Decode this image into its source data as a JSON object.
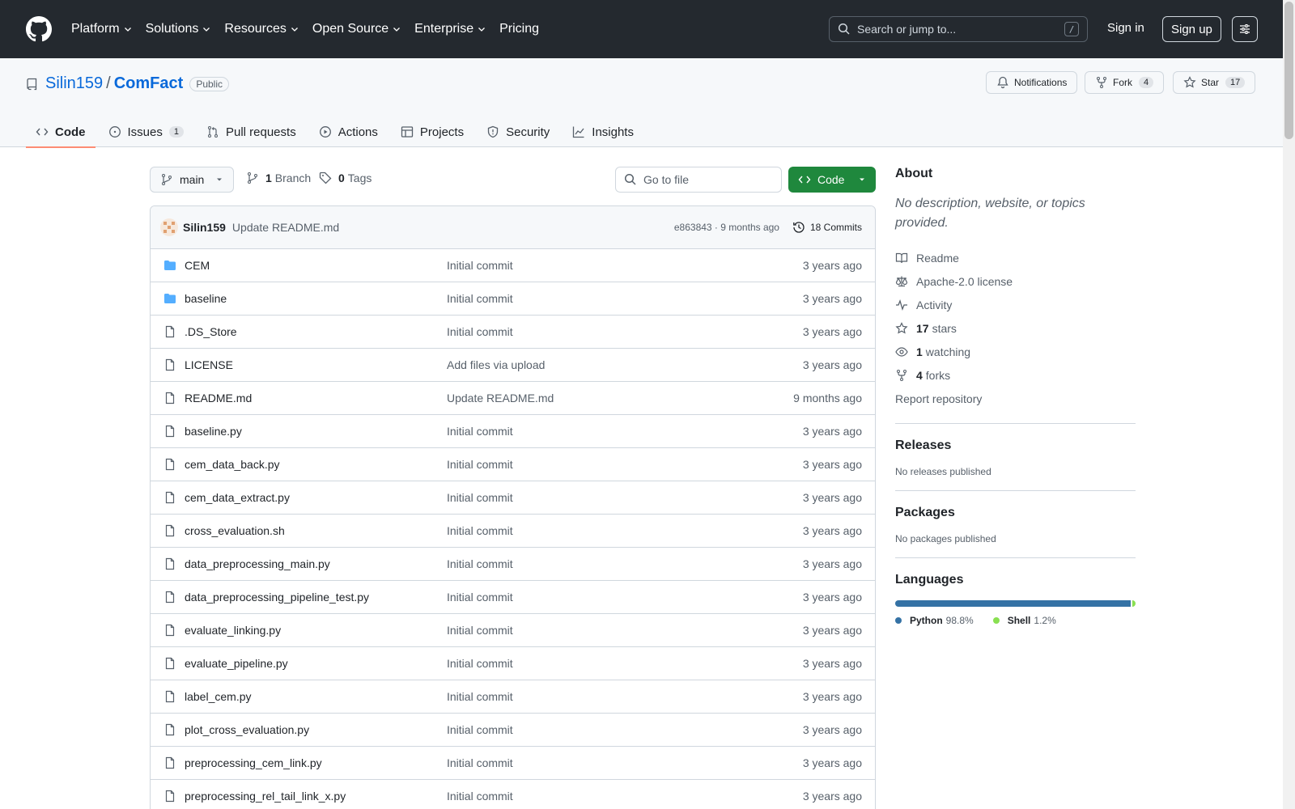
{
  "header": {
    "nav": [
      {
        "label": "Platform",
        "dropdown": true
      },
      {
        "label": "Solutions",
        "dropdown": true
      },
      {
        "label": "Resources",
        "dropdown": true
      },
      {
        "label": "Open Source",
        "dropdown": true
      },
      {
        "label": "Enterprise",
        "dropdown": true
      },
      {
        "label": "Pricing",
        "dropdown": false
      }
    ],
    "search_placeholder": "Search or jump to...",
    "search_shortcut": "/",
    "signin": "Sign in",
    "signup": "Sign up"
  },
  "repo": {
    "owner": "Silin159",
    "separator": "/",
    "name": "ComFact",
    "visibility": "Public",
    "notifications_label": "Notifications",
    "fork_label": "Fork",
    "fork_count": "4",
    "star_label": "Star",
    "star_count": "17"
  },
  "tabs": [
    {
      "label": "Code",
      "icon": "code-icon",
      "count": ""
    },
    {
      "label": "Issues",
      "icon": "issue-icon",
      "count": "1"
    },
    {
      "label": "Pull requests",
      "icon": "pull-request-icon",
      "count": ""
    },
    {
      "label": "Actions",
      "icon": "play-icon",
      "count": ""
    },
    {
      "label": "Projects",
      "icon": "table-icon",
      "count": ""
    },
    {
      "label": "Security",
      "icon": "shield-icon",
      "count": ""
    },
    {
      "label": "Insights",
      "icon": "graph-icon",
      "count": ""
    }
  ],
  "toolbar": {
    "branch": "main",
    "branches_count": "1",
    "branches_label": "Branch",
    "tags_count": "0",
    "tags_label": "Tags",
    "goto_placeholder": "Go to file",
    "code_label": "Code"
  },
  "last_commit": {
    "author": "Silin159",
    "message": "Update README.md",
    "sha_time": "e863843 · 9 months ago",
    "commits_label": "18 Commits"
  },
  "files": [
    {
      "name": "CEM",
      "type": "dir",
      "message": "Initial commit",
      "age": "3 years ago"
    },
    {
      "name": "baseline",
      "type": "dir",
      "message": "Initial commit",
      "age": "3 years ago"
    },
    {
      "name": ".DS_Store",
      "type": "file",
      "message": "Initial commit",
      "age": "3 years ago"
    },
    {
      "name": "LICENSE",
      "type": "file",
      "message": "Add files via upload",
      "age": "3 years ago"
    },
    {
      "name": "README.md",
      "type": "file",
      "message": "Update README.md",
      "age": "9 months ago"
    },
    {
      "name": "baseline.py",
      "type": "file",
      "message": "Initial commit",
      "age": "3 years ago"
    },
    {
      "name": "cem_data_back.py",
      "type": "file",
      "message": "Initial commit",
      "age": "3 years ago"
    },
    {
      "name": "cem_data_extract.py",
      "type": "file",
      "message": "Initial commit",
      "age": "3 years ago"
    },
    {
      "name": "cross_evaluation.sh",
      "type": "file",
      "message": "Initial commit",
      "age": "3 years ago"
    },
    {
      "name": "data_preprocessing_main.py",
      "type": "file",
      "message": "Initial commit",
      "age": "3 years ago"
    },
    {
      "name": "data_preprocessing_pipeline_test.py",
      "type": "file",
      "message": "Initial commit",
      "age": "3 years ago"
    },
    {
      "name": "evaluate_linking.py",
      "type": "file",
      "message": "Initial commit",
      "age": "3 years ago"
    },
    {
      "name": "evaluate_pipeline.py",
      "type": "file",
      "message": "Initial commit",
      "age": "3 years ago"
    },
    {
      "name": "label_cem.py",
      "type": "file",
      "message": "Initial commit",
      "age": "3 years ago"
    },
    {
      "name": "plot_cross_evaluation.py",
      "type": "file",
      "message": "Initial commit",
      "age": "3 years ago"
    },
    {
      "name": "preprocessing_cem_link.py",
      "type": "file",
      "message": "Initial commit",
      "age": "3 years ago"
    },
    {
      "name": "preprocessing_rel_tail_link_x.py",
      "type": "file",
      "message": "Initial commit",
      "age": "3 years ago"
    }
  ],
  "sidebar": {
    "about_title": "About",
    "about_desc": "No description, website, or topics provided.",
    "links": [
      {
        "icon": "book-icon",
        "bold": "",
        "label": "Readme"
      },
      {
        "icon": "law-icon",
        "bold": "",
        "label": "Apache-2.0 license"
      },
      {
        "icon": "pulse-icon",
        "bold": "",
        "label": "Activity"
      },
      {
        "icon": "star-icon",
        "bold": "17",
        "label": "stars"
      },
      {
        "icon": "eye-icon",
        "bold": "1",
        "label": "watching"
      },
      {
        "icon": "fork-icon",
        "bold": "4",
        "label": "forks"
      }
    ],
    "report": "Report repository",
    "releases_title": "Releases",
    "releases_note": "No releases published",
    "packages_title": "Packages",
    "packages_note": "No packages published",
    "languages_title": "Languages",
    "languages": [
      {
        "name": "Python",
        "percent": "98.8%",
        "share": 98.8,
        "color": "#3572A5"
      },
      {
        "name": "Shell",
        "percent": "1.2%",
        "share": 1.2,
        "color": "#89e051"
      }
    ]
  },
  "colors": {
    "header_bg": "#24292f",
    "link": "#0969da",
    "primary_button": "#1f883d",
    "folder": "#54aeff",
    "active_tab_underline": "#fd8c73"
  }
}
